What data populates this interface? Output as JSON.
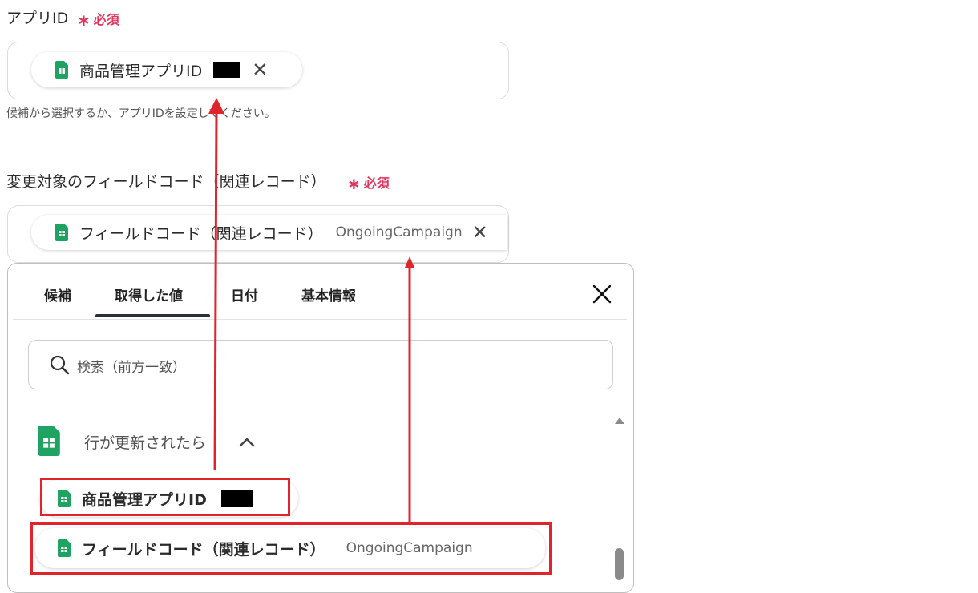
{
  "app_field": {
    "label": "アプリID",
    "required": "必須",
    "chip_label": "商品管理アプリID",
    "hint": "候補から選択するか、アプリIDを設定してください。"
  },
  "field_code": {
    "label": "変更対象のフィールドコード（関連レコード）",
    "required": "必須",
    "chip_label": "フィールドコード（関連レコード）",
    "chip_value": "OngoingCampaign"
  },
  "picker": {
    "tabs": [
      {
        "label": "候補"
      },
      {
        "label": "取得した値"
      },
      {
        "label": "日付"
      },
      {
        "label": "基本情報"
      }
    ],
    "active_tab": "取得した値",
    "search_placeholder": "検索（前方一致）",
    "group": {
      "title": "行が更新されたら",
      "items": [
        {
          "label": "商品管理アプリID",
          "value": ""
        },
        {
          "label": "フィールドコード（関連レコード）",
          "value": "OngoingCampaign"
        }
      ]
    }
  },
  "colors": {
    "required": "#e0365f",
    "annotation": "#e0242c",
    "sheets_green": "#1ea362"
  },
  "icons": {
    "sheets": "google-sheets-icon",
    "close": "close-icon",
    "search": "search-icon",
    "collapse": "chevron-up-icon",
    "scroll_up": "triangle-up-icon"
  }
}
